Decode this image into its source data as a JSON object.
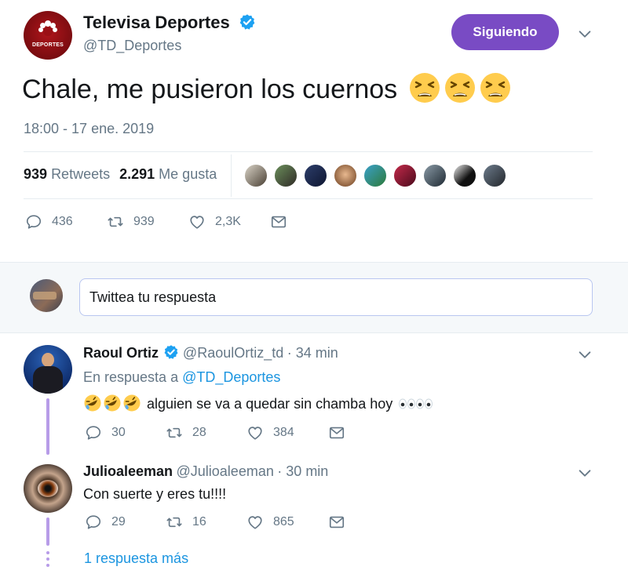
{
  "tweet": {
    "author_name": "Televisa Deportes",
    "author_handle": "@TD_Deportes",
    "logo_text": "DEPORTES",
    "follow_label": "Siguiendo",
    "text": "Chale, me pusieron los cuernos",
    "timestamp": "18:00 - 17 ene. 2019",
    "retweets_count": "939",
    "retweets_label": "Retweets",
    "likes_count": "2.291",
    "likes_label": "Me gusta",
    "actions": {
      "replies": "436",
      "retweets": "939",
      "likes": "2,3K"
    },
    "emoji": [
      "tired-face",
      "tired-face",
      "tired-face"
    ]
  },
  "compose": {
    "placeholder": "Twittea tu respuesta"
  },
  "replies": [
    {
      "name": "Raoul Ortiz",
      "handle": "@RaoulOrtiz_td",
      "time": "· 34 min",
      "reply_prefix": "En respuesta a",
      "reply_to": "@TD_Deportes",
      "text": "alguien se va a quedar sin chamba hoy",
      "actions": {
        "replies": "30",
        "retweets": "28",
        "likes": "384"
      }
    },
    {
      "name": "Julioaleeman",
      "handle": "@Julioaleeman",
      "time": "· 30 min",
      "text": "Con suerte y eres tu!!!!",
      "actions": {
        "replies": "29",
        "retweets": "16",
        "likes": "865"
      }
    }
  ],
  "more_replies": "1 respuesta más",
  "colors": {
    "accent": "#794bc4",
    "link": "#1b95e0",
    "verified": "#1da1f2",
    "muted": "#657786",
    "thread": "#b79ce8"
  }
}
